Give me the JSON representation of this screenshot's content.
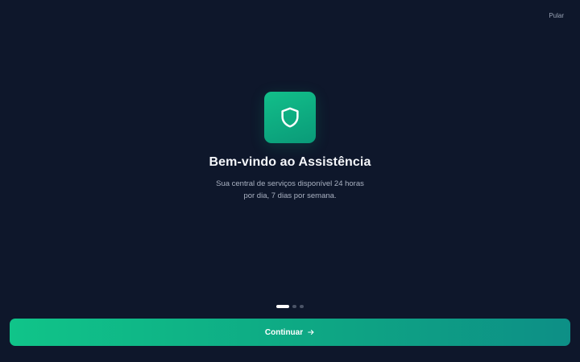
{
  "header": {
    "skip_label": "Pular"
  },
  "hero": {
    "icon": "shield-icon",
    "title": "Bem-vindo ao Assistência",
    "subtitle_line1": "Sua central de serviços disponível 24 horas",
    "subtitle_line2": "por dia, 7 dias por semana."
  },
  "pagination": {
    "total": 3,
    "current": 1
  },
  "footer": {
    "continue_label": "Continuar",
    "continue_icon": "arrow-right-icon"
  },
  "colors": {
    "background": "#0e172b",
    "accent": "#10b981",
    "accent_end": "#0d8f86",
    "muted_text": "#aab2c2"
  }
}
